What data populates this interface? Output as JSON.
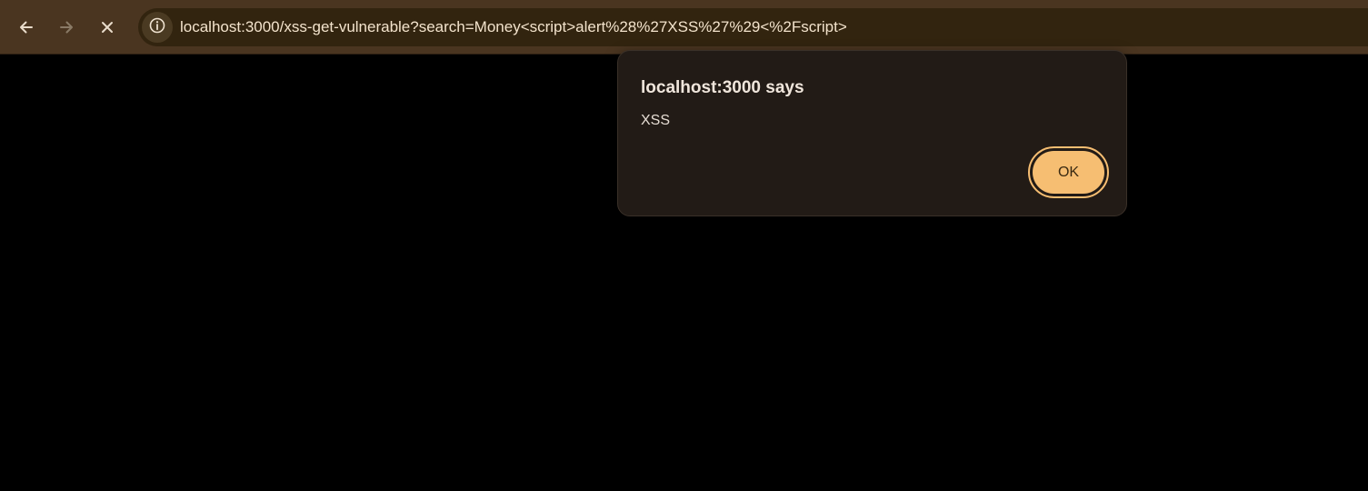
{
  "browser": {
    "url": "localhost:3000/xss-get-vulnerable?search=Money<script>alert%28%27XSS%27%29<%2Fscript>",
    "icons": {
      "back": "arrow-left-icon",
      "forward": "arrow-right-icon",
      "stop": "close-icon",
      "site_info": "info-icon"
    },
    "colors": {
      "toolbar": "#4a3520",
      "omnibox": "#32240f",
      "page_background": "#000000"
    }
  },
  "dialog": {
    "title": "localhost:3000 says",
    "message": "XSS",
    "ok_label": "OK",
    "colors": {
      "background": "#221b16",
      "button": "#f6be72",
      "button_text": "#3a2a12"
    }
  }
}
